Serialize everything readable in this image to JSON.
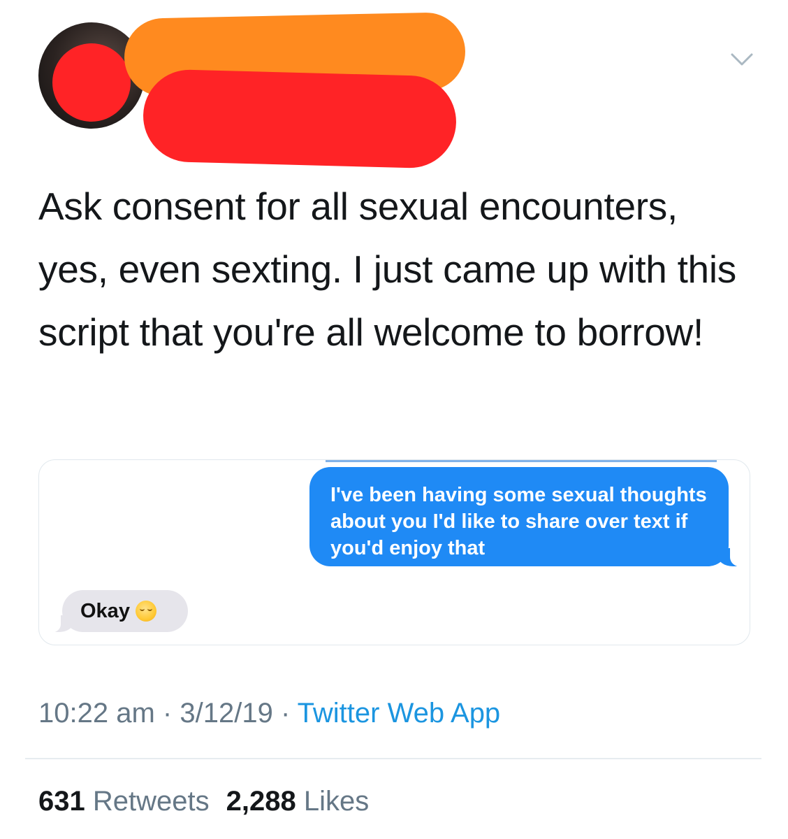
{
  "header": {
    "avatar_icon": "avatar-redacted",
    "name_redaction_color": "#ff8a1f",
    "handle_redaction_color": "#ff2326",
    "menu_icon": "chevron-down-icon"
  },
  "tweet": {
    "text": "Ask consent for all sexual encounters, yes, even sexting. I just came up with this script that you're all welcome to borrow!"
  },
  "media": {
    "sent_message": "I've been having some sexual thoughts about you I'd like to share over text if you'd enjoy that",
    "received_message": "Okay",
    "received_emoji_icon": "relieved-face-emoji-icon",
    "sent_bubble_color": "#1f8af5",
    "received_bubble_color": "#e6e5eb"
  },
  "meta": {
    "time": "10:22 am",
    "separator": "·",
    "date": "3/12/19",
    "source": "Twitter Web App",
    "source_color": "#1b95e0"
  },
  "stats": {
    "retweets_count": "631",
    "retweets_label": "Retweets",
    "likes_count": "2,288",
    "likes_label": "Likes"
  }
}
